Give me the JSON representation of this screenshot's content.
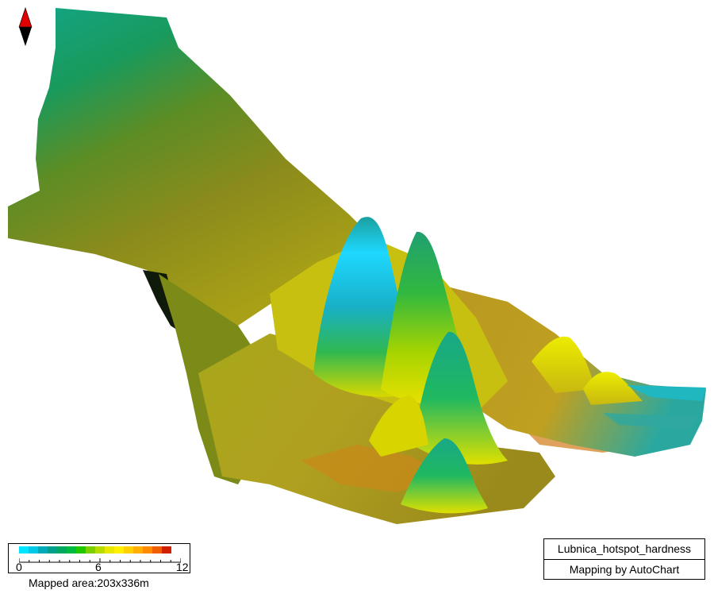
{
  "map": {
    "title": "Lubnica_hotspot_hardness",
    "credit": "Mapping by AutoChart",
    "mapped_area": "Mapped area:203x336m"
  },
  "legend": {
    "ticks": [
      "0",
      "6",
      "12"
    ],
    "min": 0,
    "max": 12,
    "colors": [
      "#00e5ff",
      "#00c8e6",
      "#00aab8",
      "#00a08c",
      "#00a860",
      "#00bb40",
      "#20c800",
      "#7ad000",
      "#b8dc00",
      "#e8e800",
      "#fff000",
      "#ffd000",
      "#ffb000",
      "#ff8c00",
      "#f06000",
      "#d02000"
    ]
  },
  "compass": {
    "icon": "north-arrow-icon",
    "north_color": "#e00000",
    "south_color": "#000000"
  }
}
